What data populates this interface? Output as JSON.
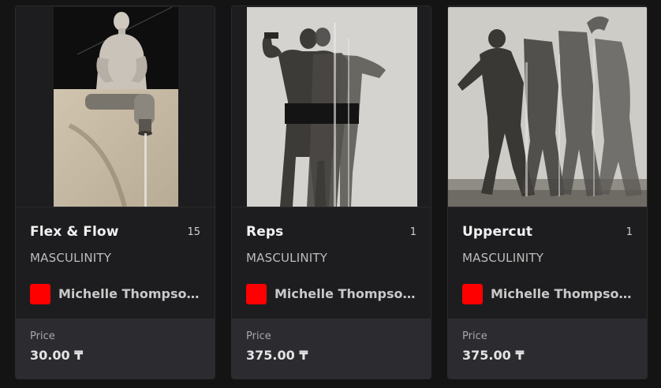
{
  "cards": [
    {
      "title": "Flex & Flow",
      "edition": "15",
      "category": "MASCULINITY",
      "artist": "Michelle Thompson...",
      "price_label": "Price",
      "price": "30.00 ₸",
      "image": "bodybuilder-faucet-collage"
    },
    {
      "title": "Reps",
      "edition": "1",
      "category": "MASCULINITY",
      "artist": "Michelle Thompson...",
      "price_label": "Price",
      "price": "375.00 ₸",
      "image": "bodybuilder-flexing-repeated-collage"
    },
    {
      "title": "Uppercut",
      "edition": "1",
      "category": "MASCULINITY",
      "artist": "Michelle Thompson...",
      "price_label": "Price",
      "price": "375.00 ₸",
      "image": "boxer-uppercut-repeated-collage"
    }
  ],
  "colors": {
    "background": "#141414",
    "card": "#1d1d1f",
    "price_box": "#2c2c30",
    "artist_avatar": "#ff0000"
  }
}
